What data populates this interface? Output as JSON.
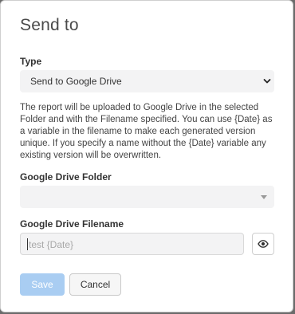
{
  "dialog": {
    "title": "Send to",
    "type": {
      "label": "Type",
      "selected": "Send to Google Drive"
    },
    "description": "The report will be uploaded to Google Drive in the selected Folder and with the Filename specified. You can use {Date} as a variable in the filename to make each generated version unique. If you specify a name without the {Date} variable any existing version will be overwritten.",
    "folder": {
      "label": "Google Drive Folder",
      "selected": ""
    },
    "filename": {
      "label": "Google Drive Filename",
      "placeholder": "test {Date}"
    },
    "buttons": {
      "save": "Save",
      "cancel": "Cancel"
    }
  },
  "icons": {
    "type_dropdown": "chevron-down-icon",
    "folder_dropdown": "caret-down-icon",
    "visibility": "eye-icon"
  },
  "colors": {
    "save_button": "#a9cdf2",
    "field_background": "#f3f3f4"
  }
}
